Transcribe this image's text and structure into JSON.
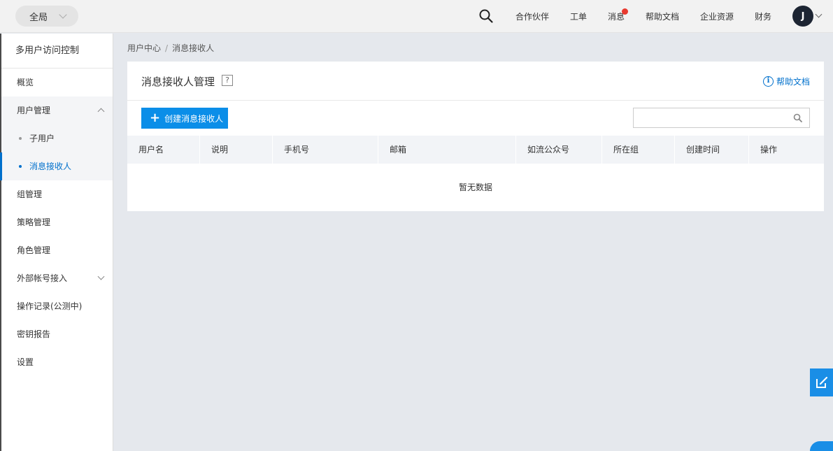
{
  "topbar": {
    "region": "全局",
    "nav": [
      "合作伙伴",
      "工单",
      "消息",
      "帮助文档",
      "企业资源",
      "财务"
    ],
    "avatar": "J"
  },
  "sidebar": {
    "title": "多用户访问控制",
    "items": {
      "overview": "概览",
      "user_mgmt": "用户管理",
      "sub_user": "子用户",
      "msg_receiver": "消息接收人",
      "group_mgmt": "组管理",
      "policy_mgmt": "策略管理",
      "role_mgmt": "角色管理",
      "external": "外部帐号接入",
      "op_log": "操作记录(公测中)",
      "key_report": "密钥报告",
      "settings": "设置"
    }
  },
  "breadcrumb": {
    "parent": "用户中心",
    "separator": "/",
    "current": "消息接收人"
  },
  "panel": {
    "title": "消息接收人管理",
    "help_icon": "?",
    "help_link": "帮助文档",
    "create_button": "创建消息接收人",
    "search_placeholder": "",
    "columns": [
      "用户名",
      "说明",
      "手机号",
      "邮箱",
      "如流公众号",
      "所在组",
      "创建时间",
      "操作"
    ],
    "empty_text": "暂无数据"
  },
  "colors": {
    "accent": "#0b8ee8",
    "link": "#0070cc",
    "badge": "#e8392f"
  },
  "icons": [
    "search-icon",
    "chevron-down-icon",
    "chevron-up-icon",
    "plus-icon",
    "info-icon",
    "edit-icon",
    "chat-icon"
  ]
}
